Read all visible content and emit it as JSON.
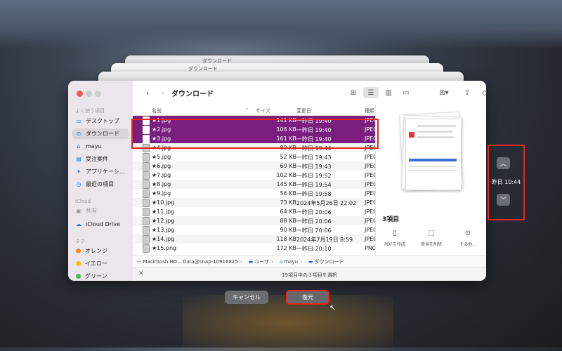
{
  "dialog": {
    "cancel_label": "キャンセル",
    "restore_label": "復元"
  },
  "time_machine": {
    "current_time": "昨日 10:44",
    "up_icon": "chevron-up-icon",
    "down_icon": "chevron-down-icon"
  },
  "stack_titles": [
    "ダウンロード",
    "ダウンロード"
  ],
  "sidebar": {
    "favorites_header": "よく使う項目",
    "favorites": [
      {
        "label": "デスクトップ",
        "icon": "desktop-icon",
        "glyph": "▭"
      },
      {
        "label": "ダウンロード",
        "icon": "download-icon",
        "glyph": "⊙"
      },
      {
        "label": "mayu",
        "icon": "home-icon",
        "glyph": "⌂"
      },
      {
        "label": "受注案件",
        "icon": "folder-icon",
        "glyph": "▤"
      },
      {
        "label": "アプリケーシ…",
        "icon": "applications-icon",
        "glyph": "✦"
      },
      {
        "label": "最近の項目",
        "icon": "clock-icon",
        "glyph": "◷"
      }
    ],
    "icloud_header": "iCloud",
    "icloud": [
      {
        "label": "共有",
        "icon": "shared-icon",
        "glyph": "▣"
      },
      {
        "label": "iCloud Drive",
        "icon": "cloud-icon",
        "glyph": "☁"
      }
    ],
    "tags_header": "タグ",
    "tags": [
      {
        "label": "オレンジ",
        "color": "#f5892b"
      },
      {
        "label": "イエロー",
        "color": "#f2c318"
      },
      {
        "label": "グリーン",
        "color": "#4cbb4f"
      }
    ]
  },
  "toolbar": {
    "title": "ダウンロード"
  },
  "columns": {
    "name": "名前",
    "size": "サイズ",
    "date": "変更日",
    "kind": "種類"
  },
  "files": [
    {
      "name": "★1.jpg",
      "size": "141 KB",
      "date": "一昨日 19:40",
      "kind": "JPEG"
    },
    {
      "name": "★2.jpg",
      "size": "106 KB",
      "date": "一昨日 19:40",
      "kind": "JPEG"
    },
    {
      "name": "★3.jpg",
      "size": "161 KB",
      "date": "一昨日 19:40",
      "kind": "JPEG"
    },
    {
      "name": "★4.jpg",
      "size": "80 KB",
      "date": "一昨日 19:44",
      "kind": "JPEG"
    },
    {
      "name": "★5.jpg",
      "size": "52 KB",
      "date": "一昨日 19:43",
      "kind": "JPEG"
    },
    {
      "name": "★6.jpg",
      "size": "69 KB",
      "date": "一昨日 19:43",
      "kind": "JPEG"
    },
    {
      "name": "★7.jpg",
      "size": "102 KB",
      "date": "一昨日 19:52",
      "kind": "JPEG"
    },
    {
      "name": "★8.jpg",
      "size": "145 KB",
      "date": "一昨日 19:54",
      "kind": "JPEG"
    },
    {
      "name": "★9.jpg",
      "size": "56 KB",
      "date": "一昨日 19:58",
      "kind": "JPEG"
    },
    {
      "name": "★10.jpg",
      "size": "73 KB",
      "date": "2024年5月26日 22:02",
      "kind": "JPEG"
    },
    {
      "name": "★11.jpg",
      "size": "64 KB",
      "date": "一昨日 20:06",
      "kind": "JPEG"
    },
    {
      "name": "★12.jpg",
      "size": "88 KB",
      "date": "一昨日 20:06",
      "kind": "JPEG"
    },
    {
      "name": "★13.jpg",
      "size": "90 KB",
      "date": "一昨日 20:06",
      "kind": "JPEG"
    },
    {
      "name": "★14.jpg",
      "size": "118 KB",
      "date": "2024年7月19日 8:59",
      "kind": "JPEG"
    },
    {
      "name": "★15.png",
      "size": "172 KB",
      "date": "一昨日 20:10",
      "kind": "PNG"
    }
  ],
  "preview": {
    "count_label": "3項目",
    "actions": [
      {
        "label": "PDFを作成",
        "icon": "document-icon"
      },
      {
        "label": "背景を削除",
        "icon": "remove-background-icon"
      },
      {
        "label": "その他...",
        "icon": "more-icon"
      }
    ]
  },
  "path": [
    "Macintosh HD – Data@snap-10916825",
    "ユーザ",
    "mayu",
    "ダウンロード"
  ],
  "status": "19項目中の３項目を選択"
}
